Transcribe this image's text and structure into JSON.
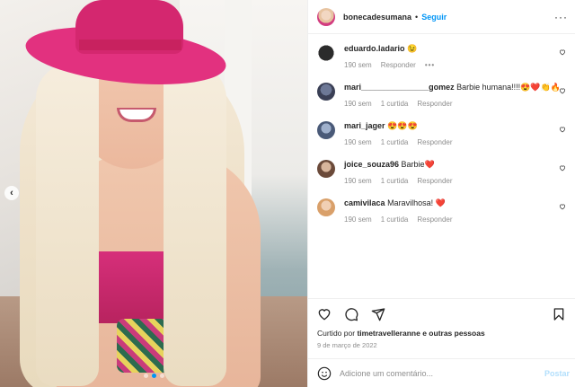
{
  "post": {
    "author": "bonecadesumana",
    "separator": "•",
    "follow_label": "Seguir",
    "more_label": "···"
  },
  "media": {
    "prev_arrow": "‹",
    "carousel_index": 2,
    "carousel_count": 3
  },
  "comments": [
    {
      "user": "eduardo.ladario",
      "text": "😉",
      "age": "190 sem",
      "likes": "",
      "reply": "Responder",
      "options": "•••",
      "avatar_color": "#2b2b2b",
      "owner_comment": true
    },
    {
      "user": "mari_______________gomez",
      "text": "Barbie humana!!!!😍❤️👏🔥",
      "age": "190 sem",
      "likes": "1 curtida",
      "reply": "Responder",
      "avatar_color": "#3a3f55"
    },
    {
      "user": "mari_jager",
      "text": "😍😍😍",
      "age": "190 sem",
      "likes": "1 curtida",
      "reply": "Responder",
      "avatar_color": "#4a5a78"
    },
    {
      "user": "joice_souza96",
      "text": "Barbie❤️",
      "age": "190 sem",
      "likes": "1 curtida",
      "reply": "Responder",
      "avatar_color": "#6b4a3a"
    },
    {
      "user": "camivilaca",
      "text": "Maravilhosa! ❤️",
      "age": "190 sem",
      "likes": "1 curtida",
      "reply": "Responder",
      "avatar_color": "#d9a06a"
    }
  ],
  "likes": {
    "prefix": "Curtido por",
    "user": "timetravelleranne",
    "suffix": "e outras pessoas"
  },
  "date": "9 de março de 2022",
  "composer": {
    "placeholder": "Adicione um comentário...",
    "post_label": "Postar"
  },
  "colors": {
    "accent": "#0095f6",
    "post_disabled": "#b2dffc",
    "muted": "#8e8e8e",
    "text": "#262626",
    "heart_red": "#ed4956"
  }
}
